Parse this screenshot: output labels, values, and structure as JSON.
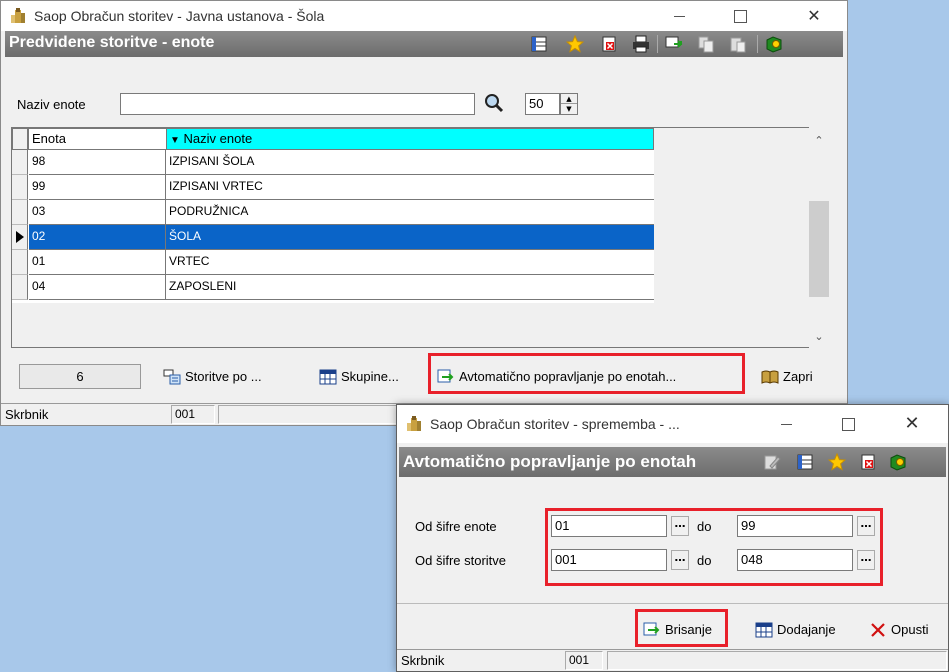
{
  "main_window": {
    "title": "Saop Obračun storitev - Javna ustanova - Šola",
    "header_title": "Predvidene storitve - enote",
    "search": {
      "label": "Naziv enote",
      "value": "",
      "limit_value": "50"
    },
    "grid": {
      "columns": [
        "Enota",
        "Naziv enote"
      ],
      "sort_indicator": "▼",
      "rows": [
        {
          "code": "98",
          "name": "IZPISANI ŠOLA",
          "selected": false
        },
        {
          "code": "99",
          "name": "IZPISANI VRTEC",
          "selected": false
        },
        {
          "code": "03",
          "name": "PODRUŽNICA",
          "selected": false
        },
        {
          "code": "02",
          "name": "ŠOLA",
          "selected": true
        },
        {
          "code": "01",
          "name": "VRTEC",
          "selected": false
        },
        {
          "code": "04",
          "name": "ZAPOSLENI",
          "selected": false
        }
      ]
    },
    "record_count": "6",
    "buttons": {
      "storitve": "Storitve po ...",
      "skupine": "Skupine...",
      "avtomaticno": "Avtomatično popravljanje po enotah...",
      "zapri": "Zapri"
    },
    "status": {
      "label": "Skrbnik",
      "value": "001"
    }
  },
  "dialog": {
    "title": "Saop Obračun storitev - sprememba - ...",
    "header_title": "Avtomatično popravljanje po enotah",
    "enote": {
      "label": "Od šifre enote",
      "from": "01",
      "to_label": "do",
      "to": "99"
    },
    "storitve": {
      "label": "Od šifre storitve",
      "from": "001",
      "to_label": "do",
      "to": "048"
    },
    "buttons": {
      "brisanje": "Brisanje",
      "dodajanje": "Dodajanje",
      "opusti": "Opusti"
    },
    "status": {
      "label": "Skrbnik",
      "value": "001"
    }
  },
  "colors": {
    "highlight": "#e8202a",
    "selected_row": "#0a64c8",
    "sort_header": "#00ffff",
    "header_bar": "#7a7a7a",
    "desktop": "#a8c8ea"
  },
  "icons": [
    "app-icon",
    "columns-icon",
    "star-icon",
    "delete-icon",
    "print-icon",
    "export-icon",
    "copy-icon",
    "paste-icon",
    "help-icon",
    "search-icon",
    "edit-icon",
    "document-icon",
    "table-icon",
    "book-icon",
    "close-x-icon"
  ]
}
